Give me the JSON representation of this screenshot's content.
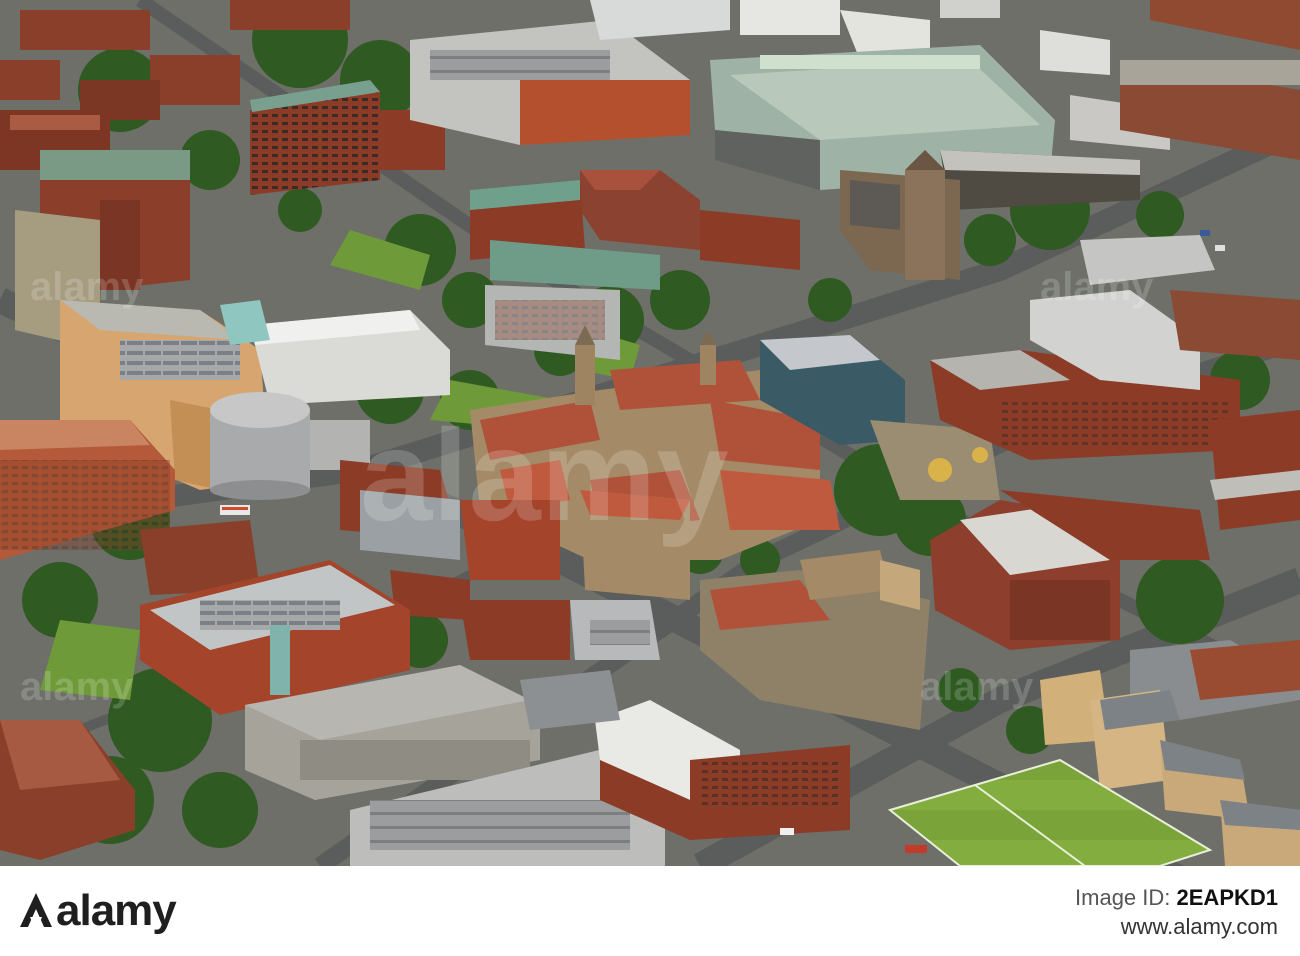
{
  "image": {
    "subject": "aerial-city-campus",
    "colors": {
      "sky_haze": "#6f7566",
      "brick": "#8a3f2a",
      "roof_red": "#b0523a",
      "sandstone": "#a48a66",
      "concrete": "#bcbdb8",
      "roof_grey": "#8d9092",
      "tree": "#2f5a22",
      "grass": "#7fa53c",
      "road": "#5b5d5c",
      "pitch": "#7aa43a"
    }
  },
  "watermark": {
    "text": "alamy"
  },
  "stock_bar": {
    "logo_text": "alamy",
    "id_label": "Image ID:",
    "id_value": "2EAPKD1",
    "site": "www.alamy.com"
  }
}
